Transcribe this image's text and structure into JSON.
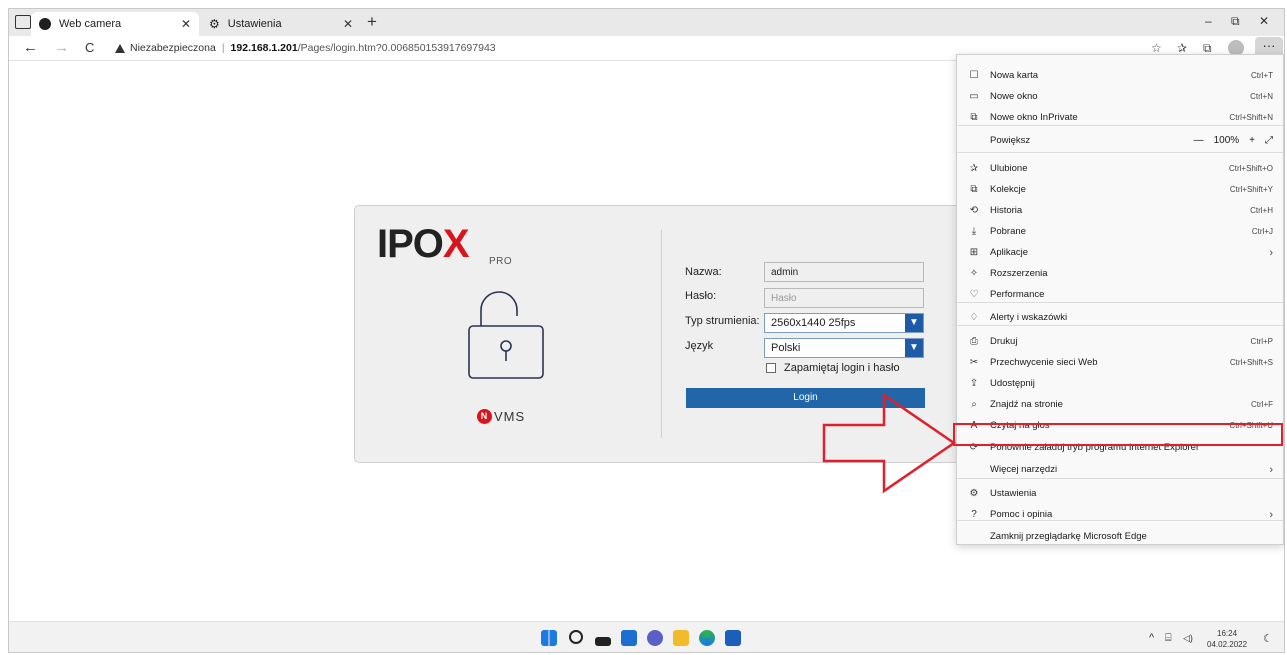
{
  "tabs": [
    {
      "title": "Web camera",
      "close": "✕"
    },
    {
      "title": "Ustawienia",
      "close": "✕"
    }
  ],
  "new_tab_icon": "+",
  "window_controls": {
    "minimize": "–",
    "restore": "⧉",
    "close": "✕"
  },
  "address": {
    "insecure_label": "Niezabezpieczona",
    "separator": "|",
    "host": "192.168.1.201",
    "path": "/Pages/login.htm?0.006850153917697943"
  },
  "nav": {
    "back": "←",
    "forward": "→",
    "refresh": "C"
  },
  "toolbar": {
    "favorites_add": "☆",
    "favorites": "✰",
    "collections": "⧉",
    "more": "···"
  },
  "login": {
    "logo_text": "IPO",
    "logo_x": "X",
    "logo_sub": "PRO",
    "brand_n": "N",
    "brand_text": "VMS",
    "name_label": "Nazwa:",
    "name_value": "admin",
    "password_label": "Hasło:",
    "password_placeholder": "Hasło",
    "stream_label": "Typ strumienia:",
    "stream_value": "2560x1440 25fps",
    "language_label": "Język",
    "language_value": "Polski",
    "remember_label": "Zapamiętaj login i hasło",
    "login_button": "Login",
    "dropdown_arrow": "▼"
  },
  "menu": {
    "items": [
      {
        "icon": "☐",
        "label": "Nowa karta",
        "shortcut": "Ctrl+T"
      },
      {
        "icon": "▭",
        "label": "Nowe okno",
        "shortcut": "Ctrl+N"
      },
      {
        "icon": "⧉",
        "label": "Nowe okno InPrivate",
        "shortcut": "Ctrl+Shift+N"
      },
      {
        "icon": "",
        "label": "Powiększ",
        "zoom": "100%",
        "minus": "—",
        "plus": "+",
        "expand": "⤢"
      },
      {
        "icon": "✰",
        "label": "Ulubione",
        "shortcut": "Ctrl+Shift+O"
      },
      {
        "icon": "⧉",
        "label": "Kolekcje",
        "shortcut": "Ctrl+Shift+Y"
      },
      {
        "icon": "⟲",
        "label": "Historia",
        "shortcut": "Ctrl+H"
      },
      {
        "icon": "⤓",
        "label": "Pobrane",
        "shortcut": "Ctrl+J"
      },
      {
        "icon": "⊞",
        "label": "Aplikacje",
        "chevron": "›"
      },
      {
        "icon": "✧",
        "label": "Rozszerzenia"
      },
      {
        "icon": "♡",
        "label": "Performance"
      },
      {
        "icon": "♢",
        "label": "Alerty i wskazówki"
      },
      {
        "icon": "⎙",
        "label": "Drukuj",
        "shortcut": "Ctrl+P"
      },
      {
        "icon": "✂",
        "label": "Przechwycenie sieci Web",
        "shortcut": "Ctrl+Shift+S"
      },
      {
        "icon": "⇪",
        "label": "Udostępnij"
      },
      {
        "icon": "⌕",
        "label": "Znajdź na stronie",
        "shortcut": "Ctrl+F"
      },
      {
        "icon": "A",
        "label": "Czytaj na głos",
        "shortcut": "Ctrl+Shift+U"
      },
      {
        "icon": "⟳",
        "label": "Ponownie załaduj tryb programu Internet Explorer"
      },
      {
        "icon": "",
        "label": "Więcej narzędzi",
        "chevron": "›"
      },
      {
        "icon": "⚙",
        "label": "Ustawienia"
      },
      {
        "icon": "?",
        "label": "Pomoc i opinia",
        "chevron": "›"
      },
      {
        "icon": "",
        "label": "Zamknij przeglądarkę Microsoft Edge"
      }
    ]
  },
  "taskbar": {
    "tray_chevron": "^",
    "tray_network": "⌸",
    "tray_volume": "◁)",
    "time": "16:24",
    "date": "04.02.2022",
    "notify": "☾"
  },
  "colors": {
    "accent_blue": "#2066a9",
    "brand_red": "#d8141e",
    "annotation_red": "#e0202a"
  }
}
